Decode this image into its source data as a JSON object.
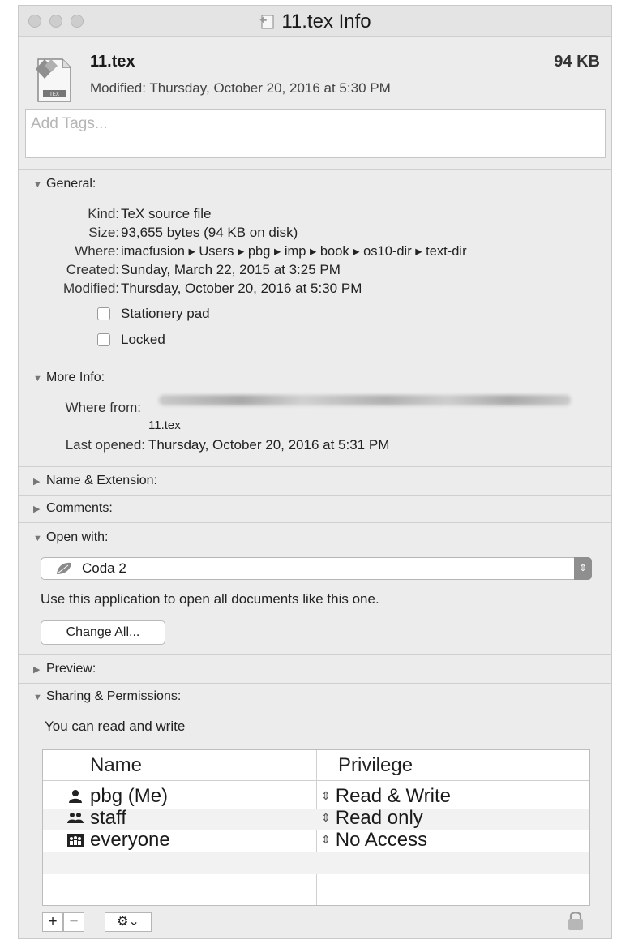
{
  "window": {
    "title": "11.tex Info"
  },
  "file": {
    "name": "11.tex",
    "size": "94 KB",
    "modified": "Modified: Thursday, October 20, 2016 at 5:30 PM"
  },
  "tags": {
    "placeholder": "Add Tags..."
  },
  "general": {
    "header": "General:",
    "rows": [
      {
        "key": "Kind:",
        "value": "TeX source file"
      },
      {
        "key": "Size:",
        "value": "93,655 bytes (94 KB on disk)"
      },
      {
        "key": "Where:",
        "value": "imacfusion ▸ Users ▸ pbg ▸ imp ▸ book ▸ os10-dir ▸ text-dir"
      },
      {
        "key": "Created:",
        "value": "Sunday, March 22, 2015 at 3:25 PM"
      },
      {
        "key": "Modified:",
        "value": "Thursday, October 20, 2016 at 5:30 PM"
      }
    ],
    "stationery_label": "Stationery pad",
    "locked_label": "Locked",
    "stationery_checked": false,
    "locked_checked": false
  },
  "more_info": {
    "header": "More Info:",
    "where_from_key": "Where from:",
    "where_from_file": "11.tex",
    "last_opened_key": "Last opened:",
    "last_opened_value": "Thursday, October 20, 2016 at 5:31 PM"
  },
  "collapsed_sections": {
    "name_extension": "Name & Extension:",
    "comments": "Comments:",
    "preview": "Preview:"
  },
  "open_with": {
    "header": "Open with:",
    "selected_app": "Coda 2",
    "description": "Use this application to open all documents like this one.",
    "change_all_label": "Change All..."
  },
  "sharing": {
    "header": "Sharing & Permissions:",
    "summary": "You can read and write",
    "columns": [
      "Name",
      "Privilege"
    ],
    "rows": [
      {
        "name": "pbg (Me)",
        "privilege": "Read & Write",
        "icon": "single-user-icon"
      },
      {
        "name": "staff",
        "privilege": "Read only",
        "icon": "group-icon"
      },
      {
        "name": "everyone",
        "privilege": "No Access",
        "icon": "everyone-icon"
      }
    ],
    "add_label": "+",
    "remove_label": "−",
    "gear_label": "⚙⌄"
  }
}
